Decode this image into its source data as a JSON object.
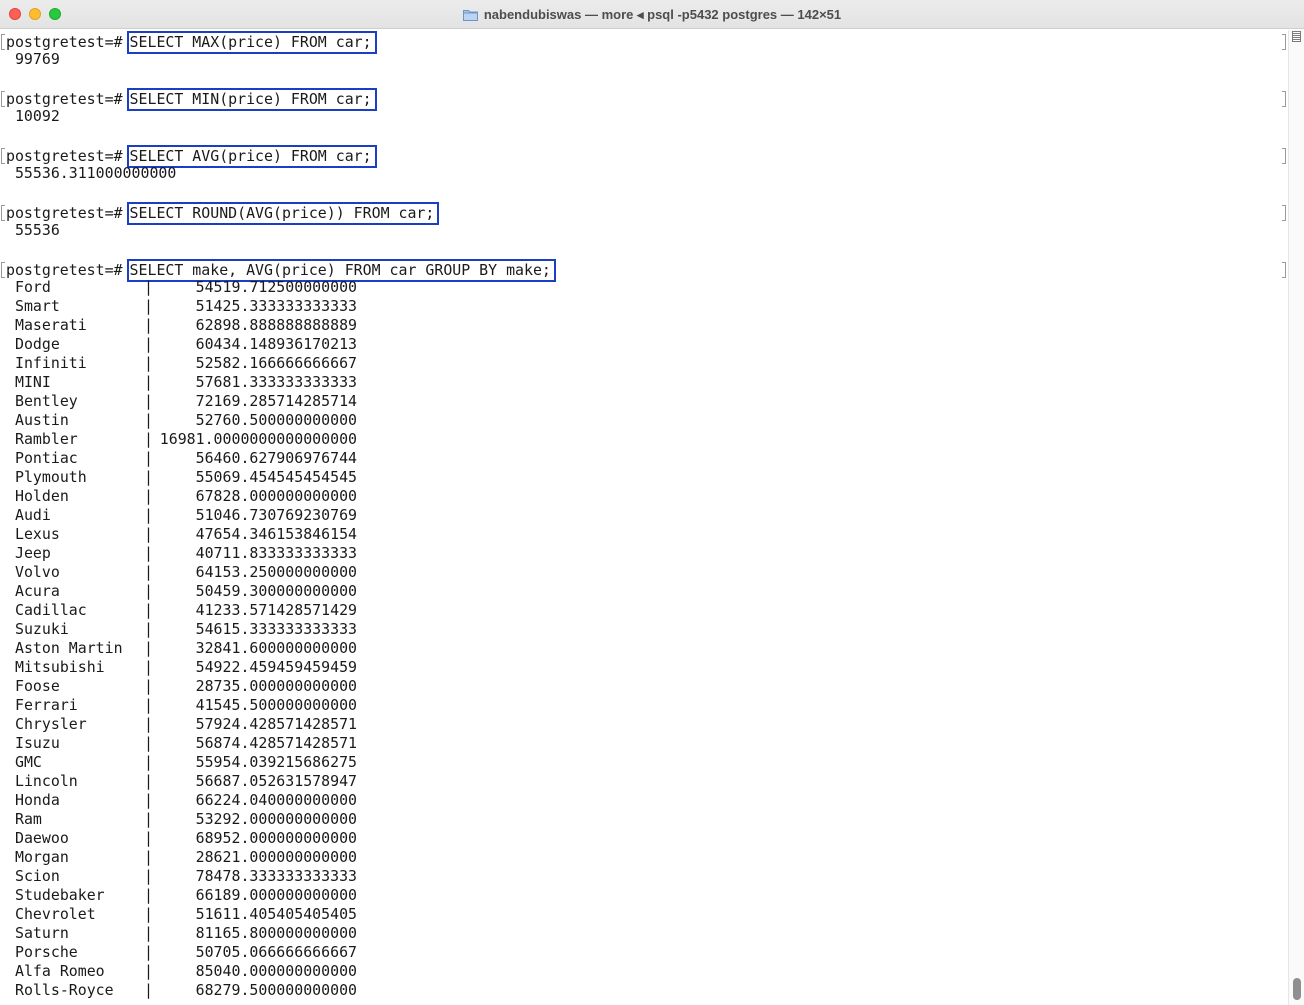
{
  "window": {
    "title": "nabendubiswas — more ◂ psql -p5432 postgres — 142×51",
    "folder_icon": "folder-icon"
  },
  "colors": {
    "highlight_box": "#1a3fc4",
    "terminal_text": "#1a1a1a"
  },
  "session": {
    "prompt": "postgretest=#",
    "commands": [
      {
        "query": "SELECT MAX(price) FROM car;",
        "result": " 99769"
      },
      {
        "query": "SELECT MIN(price) FROM car;",
        "result": " 10092"
      },
      {
        "query": "SELECT AVG(price) FROM car;",
        "result": " 55536.311000000000"
      },
      {
        "query": "SELECT ROUND(AVG(price)) FROM car;",
        "result": " 55536"
      },
      {
        "query": "SELECT make, AVG(price) FROM car GROUP BY make;",
        "result": ""
      }
    ],
    "separator": "|",
    "group_rows": [
      {
        "make": "Ford",
        "avg": "54519.712500000000"
      },
      {
        "make": "Smart",
        "avg": "51425.333333333333"
      },
      {
        "make": "Maserati",
        "avg": "62898.888888888889"
      },
      {
        "make": "Dodge",
        "avg": "60434.148936170213"
      },
      {
        "make": "Infiniti",
        "avg": "52582.166666666667"
      },
      {
        "make": "MINI",
        "avg": "57681.333333333333"
      },
      {
        "make": "Bentley",
        "avg": "72169.285714285714"
      },
      {
        "make": "Austin",
        "avg": "52760.500000000000"
      },
      {
        "make": "Rambler",
        "avg": "16981.0000000000000000"
      },
      {
        "make": "Pontiac",
        "avg": "56460.627906976744"
      },
      {
        "make": "Plymouth",
        "avg": "55069.454545454545"
      },
      {
        "make": "Holden",
        "avg": "67828.000000000000"
      },
      {
        "make": "Audi",
        "avg": "51046.730769230769"
      },
      {
        "make": "Lexus",
        "avg": "47654.346153846154"
      },
      {
        "make": "Jeep",
        "avg": "40711.833333333333"
      },
      {
        "make": "Volvo",
        "avg": "64153.250000000000"
      },
      {
        "make": "Acura",
        "avg": "50459.300000000000"
      },
      {
        "make": "Cadillac",
        "avg": "41233.571428571429"
      },
      {
        "make": "Suzuki",
        "avg": "54615.333333333333"
      },
      {
        "make": "Aston Martin",
        "avg": "32841.600000000000"
      },
      {
        "make": "Mitsubishi",
        "avg": "54922.459459459459"
      },
      {
        "make": "Foose",
        "avg": "28735.000000000000"
      },
      {
        "make": "Ferrari",
        "avg": "41545.500000000000"
      },
      {
        "make": "Chrysler",
        "avg": "57924.428571428571"
      },
      {
        "make": "Isuzu",
        "avg": "56874.428571428571"
      },
      {
        "make": "GMC",
        "avg": "55954.039215686275"
      },
      {
        "make": "Lincoln",
        "avg": "56687.052631578947"
      },
      {
        "make": "Honda",
        "avg": "66224.040000000000"
      },
      {
        "make": "Ram",
        "avg": "53292.000000000000"
      },
      {
        "make": "Daewoo",
        "avg": "68952.000000000000"
      },
      {
        "make": "Morgan",
        "avg": "28621.000000000000"
      },
      {
        "make": "Scion",
        "avg": "78478.333333333333"
      },
      {
        "make": "Studebaker",
        "avg": "66189.000000000000"
      },
      {
        "make": "Chevrolet",
        "avg": "51611.405405405405"
      },
      {
        "make": "Saturn",
        "avg": "81165.800000000000"
      },
      {
        "make": "Porsche",
        "avg": "50705.066666666667"
      },
      {
        "make": "Alfa Romeo",
        "avg": "85040.000000000000"
      },
      {
        "make": "Rolls-Royce",
        "avg": "68279.500000000000"
      }
    ]
  }
}
